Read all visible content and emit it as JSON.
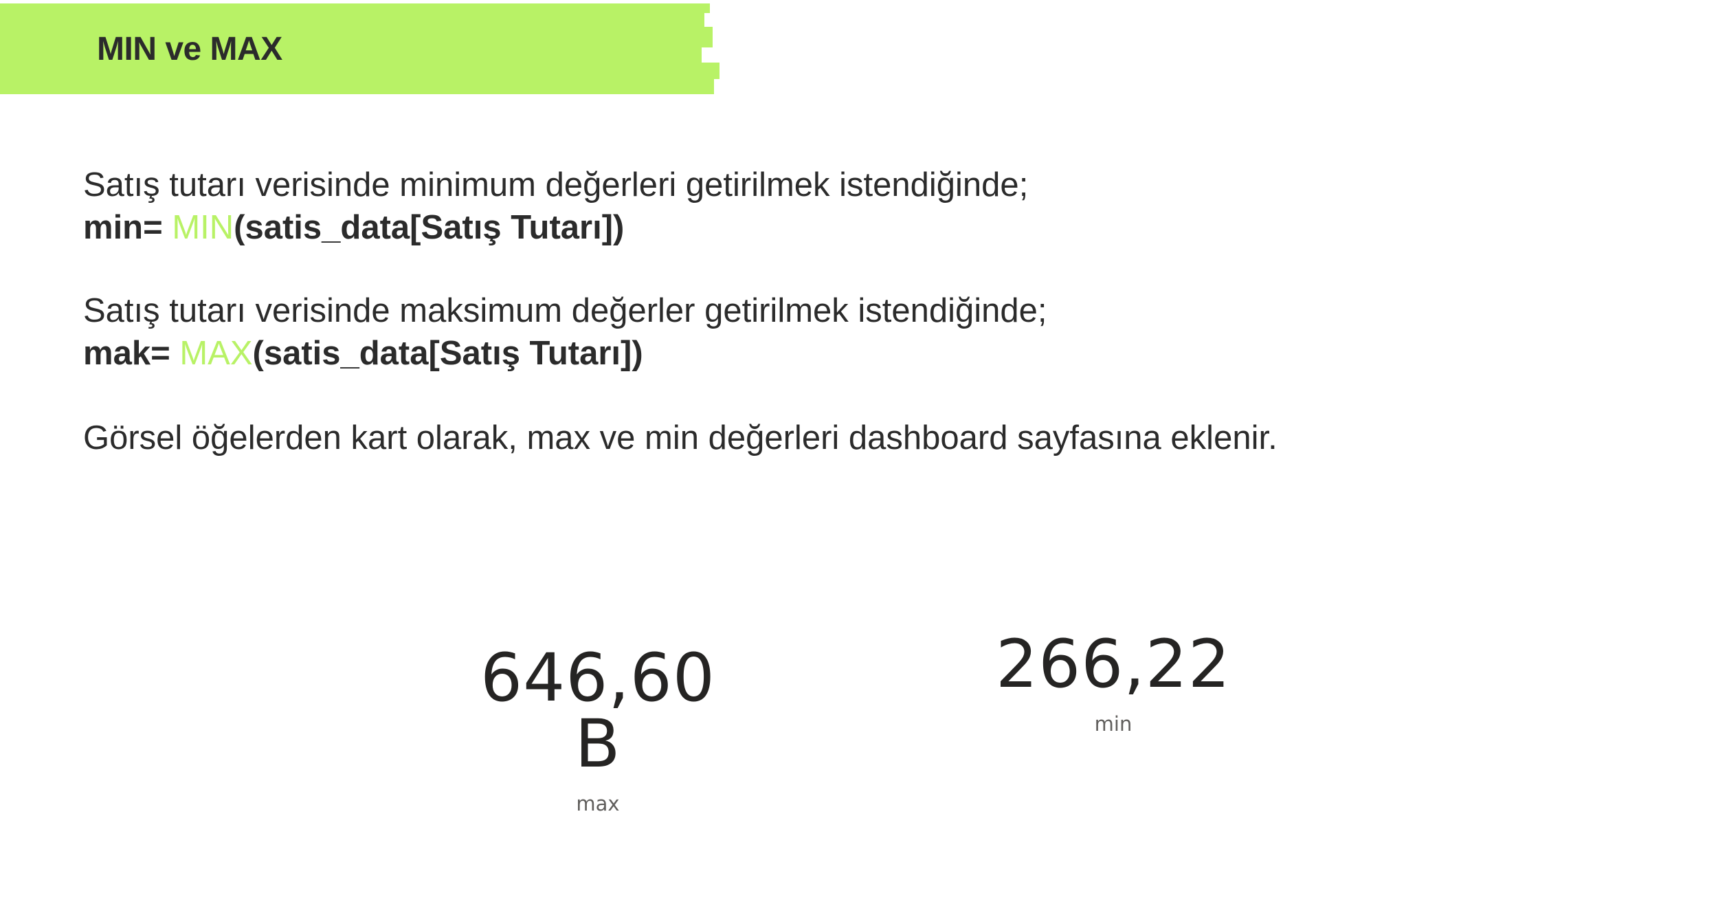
{
  "header": {
    "title": "MIN ve MAX",
    "accent_color": "#b8f266"
  },
  "content": {
    "min_description": "Satış tutarı verisinde minimum değerleri getirilmek istendiğinde;",
    "min_formula": {
      "prefix": "min= ",
      "function": "MIN",
      "argument": "(satis_data[Satış Tutarı])"
    },
    "max_description": "Satış tutarı verisinde maksimum değerler getirilmek istendiğinde;",
    "max_formula": {
      "prefix": "mak= ",
      "function": "MAX",
      "argument": "(satis_data[Satış Tutarı])"
    },
    "note": "Görsel öğelerden kart olarak, max ve min değerleri dashboard sayfasına eklenir."
  },
  "cards": {
    "max": {
      "value": "646,60 B",
      "label": "max"
    },
    "min": {
      "value": "266,22",
      "label": "min"
    }
  }
}
